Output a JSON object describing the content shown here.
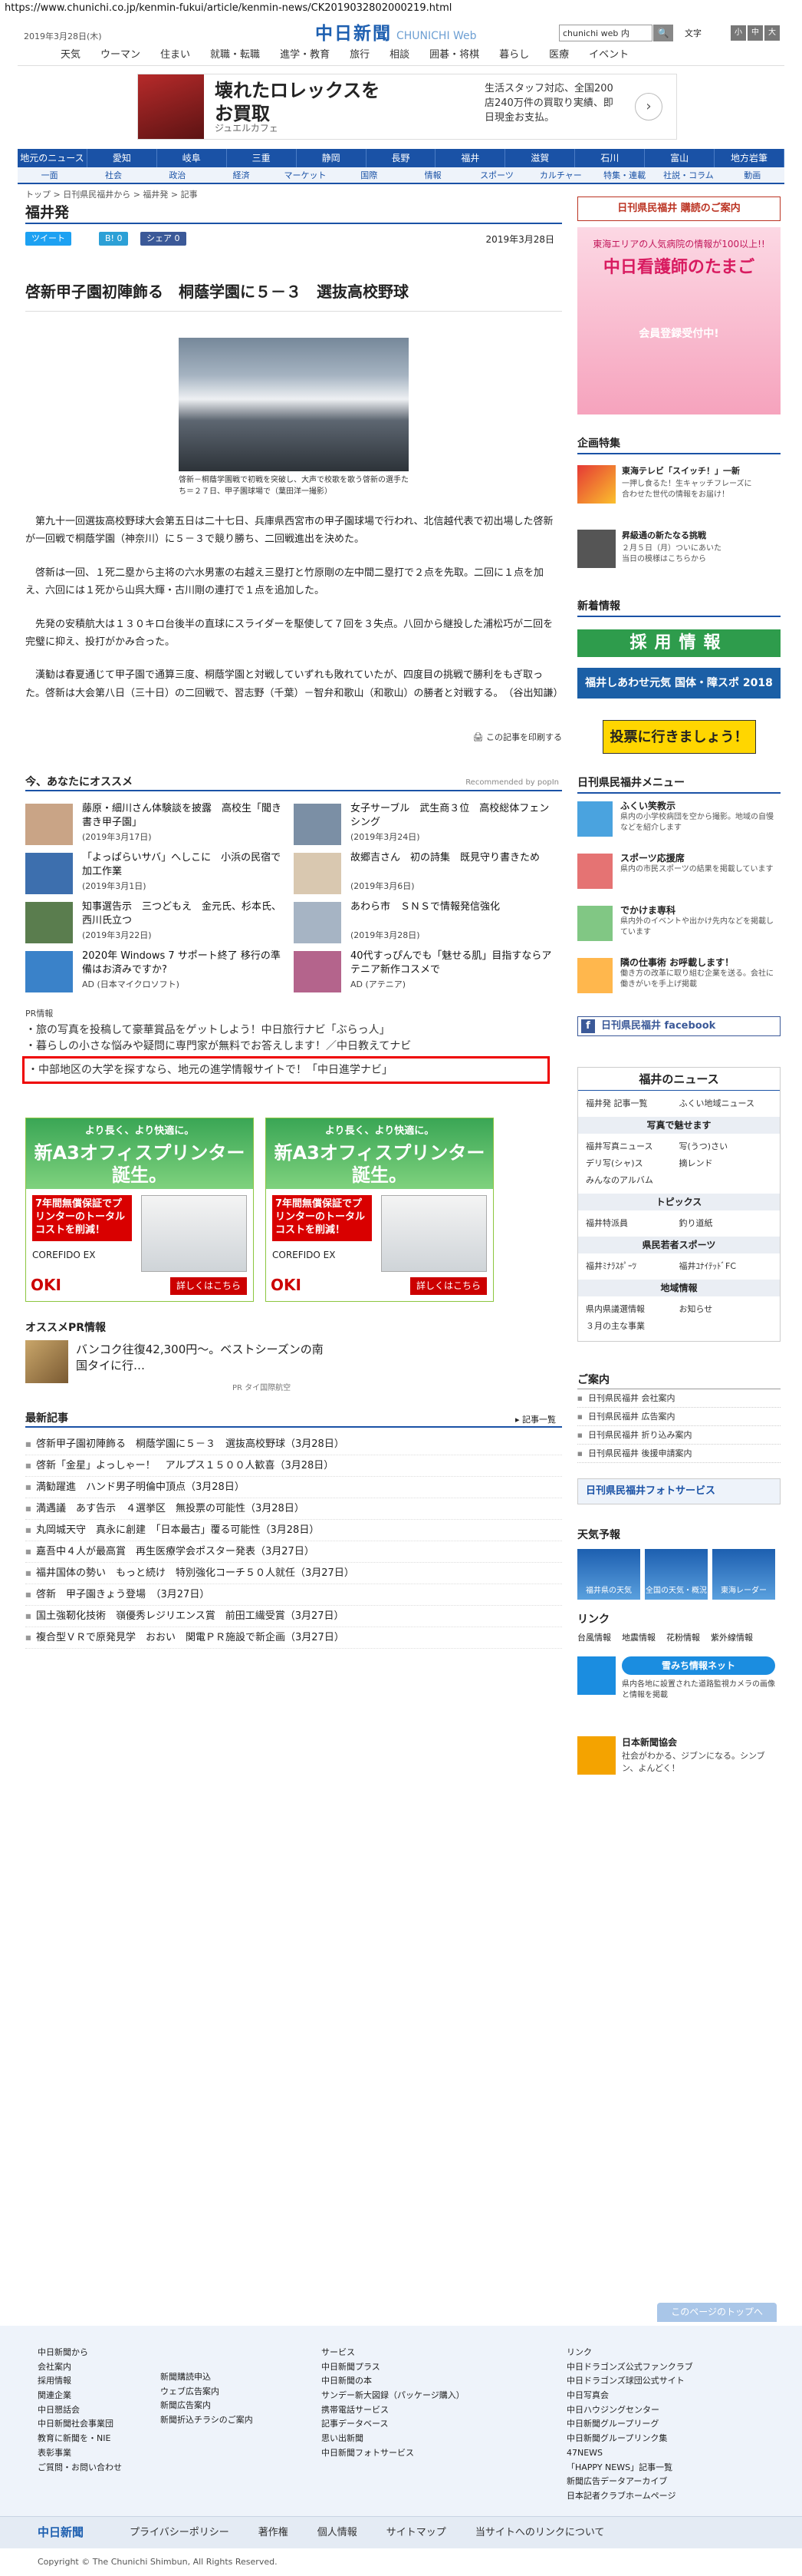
{
  "url": "https://www.chunichi.co.jp/kenmin-fukui/article/kenmin-news/CK2019032802000219.html",
  "header": {
    "date": "2019年3月28日(木)",
    "logo": "中日新聞",
    "logo_sub": "CHUNICHI Web",
    "search": "chunichi web 内",
    "search_btn": "🔍",
    "fontsize": "文字",
    "font_small": "小",
    "font_mid": "中",
    "font_large": "大"
  },
  "gnav": [
    "天気",
    "ウーマン",
    "住まい",
    "就職・転職",
    "進学・教育",
    "旅行",
    "相談",
    "囲碁・将棋",
    "暮らし",
    "医療",
    "イベント"
  ],
  "ad1": {
    "title": "壊れたロレックスを\nお買取",
    "source": "ジュエルカフェ",
    "text": "生活スタッフ対応、全国200店240万件の買取り実績、即日現金お支払。",
    "arrow": "›"
  },
  "navtop": [
    "地元のニュース",
    "愛知",
    "岐阜",
    "三重",
    "静岡",
    "長野",
    "福井",
    "滋賀",
    "石川",
    "富山",
    "地方岩筆"
  ],
  "navsub": [
    "一面",
    "社会",
    "政治",
    "経済",
    "マーケット",
    "国際",
    "情報",
    "スポーツ",
    "カルチャー",
    "特集・連載",
    "社説・コラム",
    "動画"
  ],
  "breadcrumb": "トップ > 日刊県民福井から > 福井発 > 記事",
  "page_title": "福井発",
  "share": {
    "tweet": "ツイート",
    "b": "B! 0",
    "share": "シェア 0",
    "date": "2019年3月28日"
  },
  "article": {
    "title": "啓新甲子園初陣飾る　桐蔭学園に５－３　選抜高校野球",
    "caption": "啓新－桐蔭学園戦で初戦を突破し、大声で校歌を歌う啓新の選手たち＝２７日、甲子園球場で（葉田洋一撮影）",
    "paras": [
      "第九十一回選抜高校野球大会第五日は二十七日、兵庫県西宮市の甲子園球場で行われ、北信越代表で初出場した啓新が一回戦で桐蔭学園（神奈川）に５－３で競り勝ち、二回戦進出を決めた。",
      "啓新は一回、１死二塁から主将の六水男憲の右越え三塁打と竹原剛の左中間二塁打で２点を先取。二回に１点を加え、六回には１死から山呉大輝・古川剛の連打で１点を追加した。",
      "先発の安積航大は１３０キロ台後半の直球にスライダーを駆使して７回を３失点。八回から継投した浦松巧が二回を完璧に抑え、投打がかみ合った。",
      "漢勧は春夏通じて甲子園で通算三度、桐蔭学園と対戦していずれも敗れていたが、四度目の挑戦で勝利をもぎ取った。啓新は大会第八日（三十日）の二回戦で、習志野（千葉）－智弁和歌山（和歌山）の勝者と対戦する。　（谷出知謙）"
    ],
    "print": "この記事を印刷する"
  },
  "rec": {
    "title": "今、あなたにオススメ",
    "powered": "Recommended by popIn",
    "items": [
      {
        "t": "藤原・細川さん体験談を披露　高校生「聞き書き甲子園」",
        "s": "(2019年3月17日)"
      },
      {
        "t": "女子サーブル　武生商３位　高校総体フェンシング",
        "s": "(2019年3月24日)"
      },
      {
        "t": "「よっぱらいサバ」へしこに　小浜の民宿で加工作業",
        "s": "(2019年3月1日)"
      },
      {
        "t": "故郷吉さん　初の詩集　既見守り書きため",
        "s": "(2019年3月6日)"
      },
      {
        "t": "知事選告示　三つどもえ　金元氏、杉本氏、西川氏立つ",
        "s": "(2019年3月22日)"
      },
      {
        "t": "あわら市　ＳＮＳで情報発信強化",
        "s": "(2019年3月28日)"
      },
      {
        "t": "2020年 Windows 7 サポート終了 移行の準備はお済みですか?",
        "s": "AD (日本マイクロソフト)"
      },
      {
        "t": "40代すっぴんでも「魅せる肌」目指すならアテニア新作コスメで",
        "s": "AD (アテニア)"
      }
    ]
  },
  "pr": {
    "label": "PR情報",
    "links": [
      "旅の写真を投稿して豪華賞品をゲットしよう！中日旅行ナビ「ぶらっ人」",
      "暮らしの小さな悩みや疑問に専門家が無料でお答えします！／中日教えてナビ",
      "中部地区の大学を探すなら、地元の進学情報サイトで！「中日進学ナビ」"
    ]
  },
  "adbox": {
    "g1": "より長く、より快適に。",
    "g2": "新A3オフィスプリンター誕生。",
    "red": "7年間無償保証でプリンターのトータルコストを削減！",
    "brand": "COREFIDO EX",
    "oki": "OKI",
    "detail": "詳しくはこちら"
  },
  "opr": {
    "title": "オススメPR情報",
    "item": "バンコク往復42,300円〜。ベストシーズンの南国タイに行…",
    "src": "PR タイ国際航空"
  },
  "latest": {
    "title": "最新記事",
    "more": "記事一覧",
    "items": [
      "啓新甲子園初陣飾る　桐蔭学園に５－３　選抜高校野球（3月28日）",
      "啓新「金星」よっしゃー！　アルプス１５００人歓喜（3月28日）",
      "満勧躍進　ハンド男子明倫中頂点（3月28日）",
      "満遇議　あす告示　４選挙区　無投票の可能性（3月28日）",
      "丸岡城天守　真永に創建　「日本最古」覆る可能性（3月28日）",
      "嘉吾中４人が最高賞　再生医療学会ポスター発表（3月27日）",
      "福井国体の勢い　もっと続け　特別強化コーチ５０人就任（3月27日）",
      "啓新　甲子園きょう登場　（3月27日）",
      "国土強靭化技術　嶺優秀レジリエンス賞　前田工繊受賞（3月27日）",
      "複合型ＶＲで原発見学　おおい　関電ＰＲ施設で新企画（3月27日）"
    ]
  },
  "side": {
    "btn": "日刊県民福井 購読のご案内",
    "nurse": {
      "a": "東海エリアの人気病院の情報が100以上!!",
      "b": "中日看護師のたまご",
      "c": "会員登録受付中!"
    },
    "proj_title": "企画特集",
    "proj": [
      {
        "t": "東海テレビ「スイッチ！」一新",
        "s": "一押し食るた！生キャッチフレーズに\n合わせた世代の情報をお届け！"
      },
      {
        "t": "昇級通の新たなる挑戦",
        "s": "２月５日（月）ついにあいた\n当日の模様はこちらから"
      }
    ],
    "new_title": "新着情報",
    "recruit": "採用情報",
    "recruit2": "福井しあわせ元気 国体・障スポ 2018",
    "jobs": "投票に行きましょう！",
    "menu_title": "日刊県民福井メニュー",
    "menu": [
      {
        "t": "ふくい笑教示",
        "s": "県内の小学校病団を空から撮影。地域の自慢などを紹介します"
      },
      {
        "t": "スポーツ応援席",
        "s": "県内の市民スポーツの結果を掲載しています"
      },
      {
        "t": "でかけま専科",
        "s": "県内外のイベントや出かけ先内などを掲載しています"
      },
      {
        "t": "隣の仕事術 お呼載します！",
        "s": "働き方の改革に取り組む企業を送る。会社に働きがいを手上げ掲載"
      }
    ],
    "fb": "日刊県民福井 facebook",
    "fnews": {
      "h": "福井のニュース",
      "r1": [
        "福井発 記事一覧",
        "ふくい地域ニュース"
      ],
      "s1": "写真で魅せます",
      "r2": [
        "福井写真ニュース",
        "写(うつ)さい",
        "デリ写(シャ)ス",
        "摘レンド",
        "みんなのアルバム"
      ],
      "s2": "トピックス",
      "r3": [
        "福井特派員",
        "釣り道紙"
      ],
      "s3": "県民若者スポーツ",
      "r4": [
        "福井ﾐﾅﾗｽﾎﾟｰﾂ",
        "福井ﾕﾅｲﾃｯﾄﾞFC"
      ],
      "s4": "地域情報",
      "r5": [
        "県内県議選情報",
        "お知らせ",
        "３月の主な事業"
      ]
    },
    "annai": {
      "h": "ご案内",
      "items": [
        "日刊県民福井 会社案内",
        "日刊県民福井 広告案内",
        "日刊県民福井 折り込み案内",
        "日刊県民福井 後援申請案内"
      ]
    },
    "photosrv": "日刊県民福井フォトサービス",
    "weather": {
      "h": "天気予報",
      "items": [
        "福井県の天気",
        "全国の天気・概況",
        "東海レーダー"
      ]
    },
    "link": {
      "h": "リンク",
      "items": [
        "台風情報",
        "地震情報",
        "花粉情報",
        "紫外線情報"
      ]
    },
    "banner": {
      "b": "雪みち情報ネット",
      "s": "県内各地に設置された道路監視カメラの画像と情報を掲載"
    },
    "nsc": {
      "t": "日本新聞協会",
      "s": "社会がわかる、ジブンになる。シンブン、よんどく！"
    }
  },
  "toppage": "このページのトップへ",
  "footer": {
    "cols": [
      [
        "中日新聞から",
        "会社案内",
        "採用情報",
        "関連企業",
        "中日懇話会",
        "中日新聞社会事業団",
        "教育に新聞を・NIE",
        "表彰事業",
        "ご質問・お問い合わせ"
      ],
      [
        "",
        "新聞購読申込",
        "ウェブ広告案内",
        "新聞広告案内",
        "新聞折込チラシのご案内"
      ],
      [
        "サービス",
        "中日新聞プラス",
        "中日新聞の本",
        "サンデー新大図録（パッケージ購入）",
        "携帯電話サービス",
        "記事データベース",
        "思い出新聞",
        "中日新聞フォトサービス"
      ],
      [
        "リンク",
        "中日ドラゴンズ公式ファンクラブ",
        "中日ドラゴンズ球団公式サイト",
        "中日写真会",
        "中日ハウジングセンター",
        "中日新聞グループリーグ",
        "中日新聞グループリンク集",
        "47NEWS",
        "「HAPPY NEWS」記事一覧",
        "新聞広告データアーカイブ",
        "日本記者クラブホームページ"
      ]
    ],
    "nav": [
      "プライバシーポリシー",
      "著作権",
      "個人情報",
      "サイトマップ",
      "当サイトへのリンクについて"
    ],
    "logo": "中日新聞",
    "copy": "Copyright © The Chunichi Shimbun, All Rights Reserved."
  }
}
